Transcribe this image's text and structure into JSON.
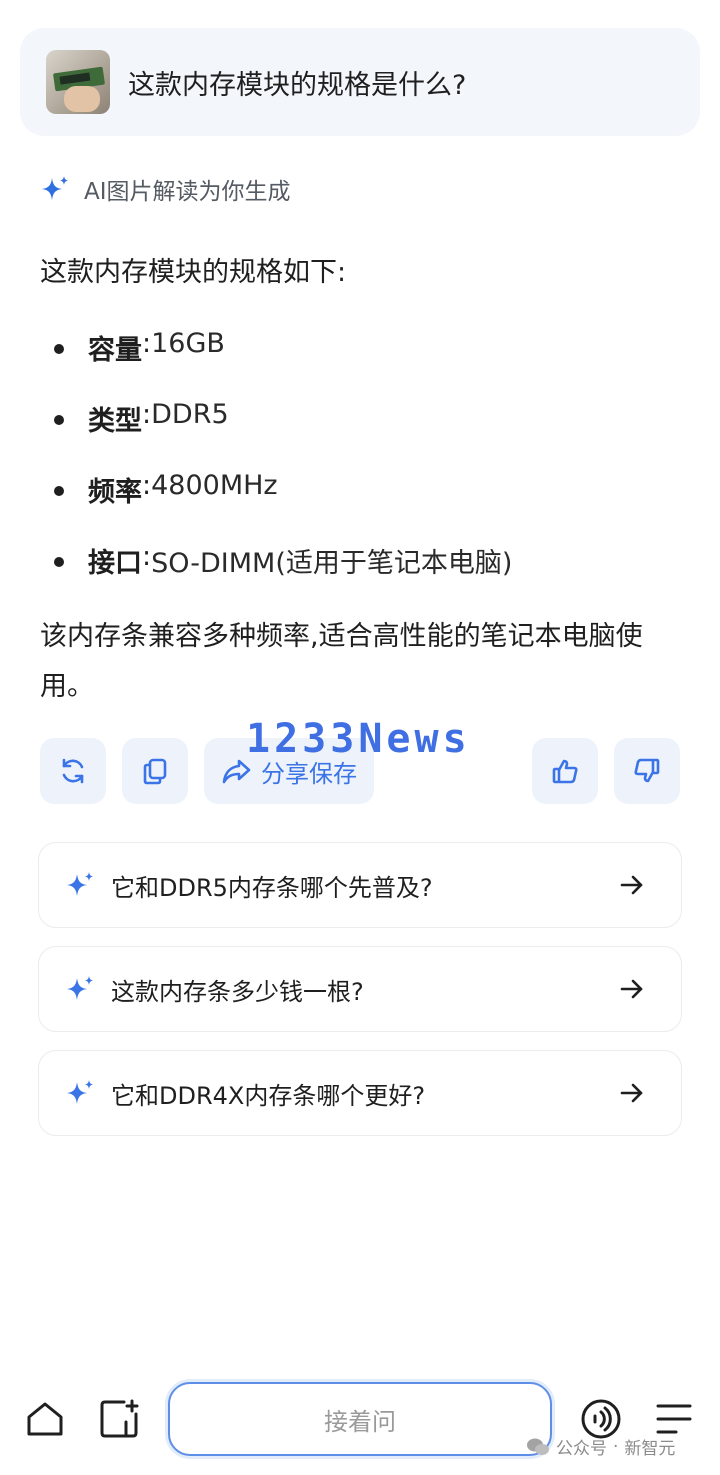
{
  "query": {
    "text": "这款内存模块的规格是什么?"
  },
  "ai_tag": {
    "label": "AI图片解读为你生成",
    "icon": "sparkle-icon",
    "color": "#2f6fe0"
  },
  "answer": {
    "intro": "这款内存模块的规格如下:",
    "specs": [
      {
        "key": "容量",
        "sep": ":",
        "value": " 16GB"
      },
      {
        "key": "类型",
        "sep": ":",
        "value": " DDR5"
      },
      {
        "key": "频率",
        "sep": ":",
        "value": " 4800MHz"
      },
      {
        "key": "接口",
        "sep": ":",
        "value": " SO-DIMM(适用于笔记本电脑)"
      }
    ],
    "note": "该内存条兼容多种频率,适合高性能的笔记本电脑使用。"
  },
  "watermark": "1233News",
  "actions": {
    "regenerate_icon": "refresh-icon",
    "copy_icon": "copy-icon",
    "share_icon": "share-icon",
    "share_label": "分享保存",
    "like_icon": "thumbs-up-icon",
    "dislike_icon": "thumbs-down-icon",
    "accent": "#3b74e6",
    "button_bg": "#eef3fb"
  },
  "suggestions": [
    {
      "text": "它和DDR5内存条哪个先普及?"
    },
    {
      "text": "这款内存条多少钱一根?"
    },
    {
      "text": "它和DDR4X内存条哪个更好?"
    }
  ],
  "bottom_bar": {
    "home_icon": "home-icon",
    "new_chat_icon": "new-chat-icon",
    "ask_placeholder": "接着问",
    "voice_icon": "voice-call-icon",
    "menu_icon": "menu-icon"
  },
  "footer_mark": {
    "account": "公众号",
    "dot": "·",
    "name": "新智元",
    "icon": "wechat-icon"
  }
}
